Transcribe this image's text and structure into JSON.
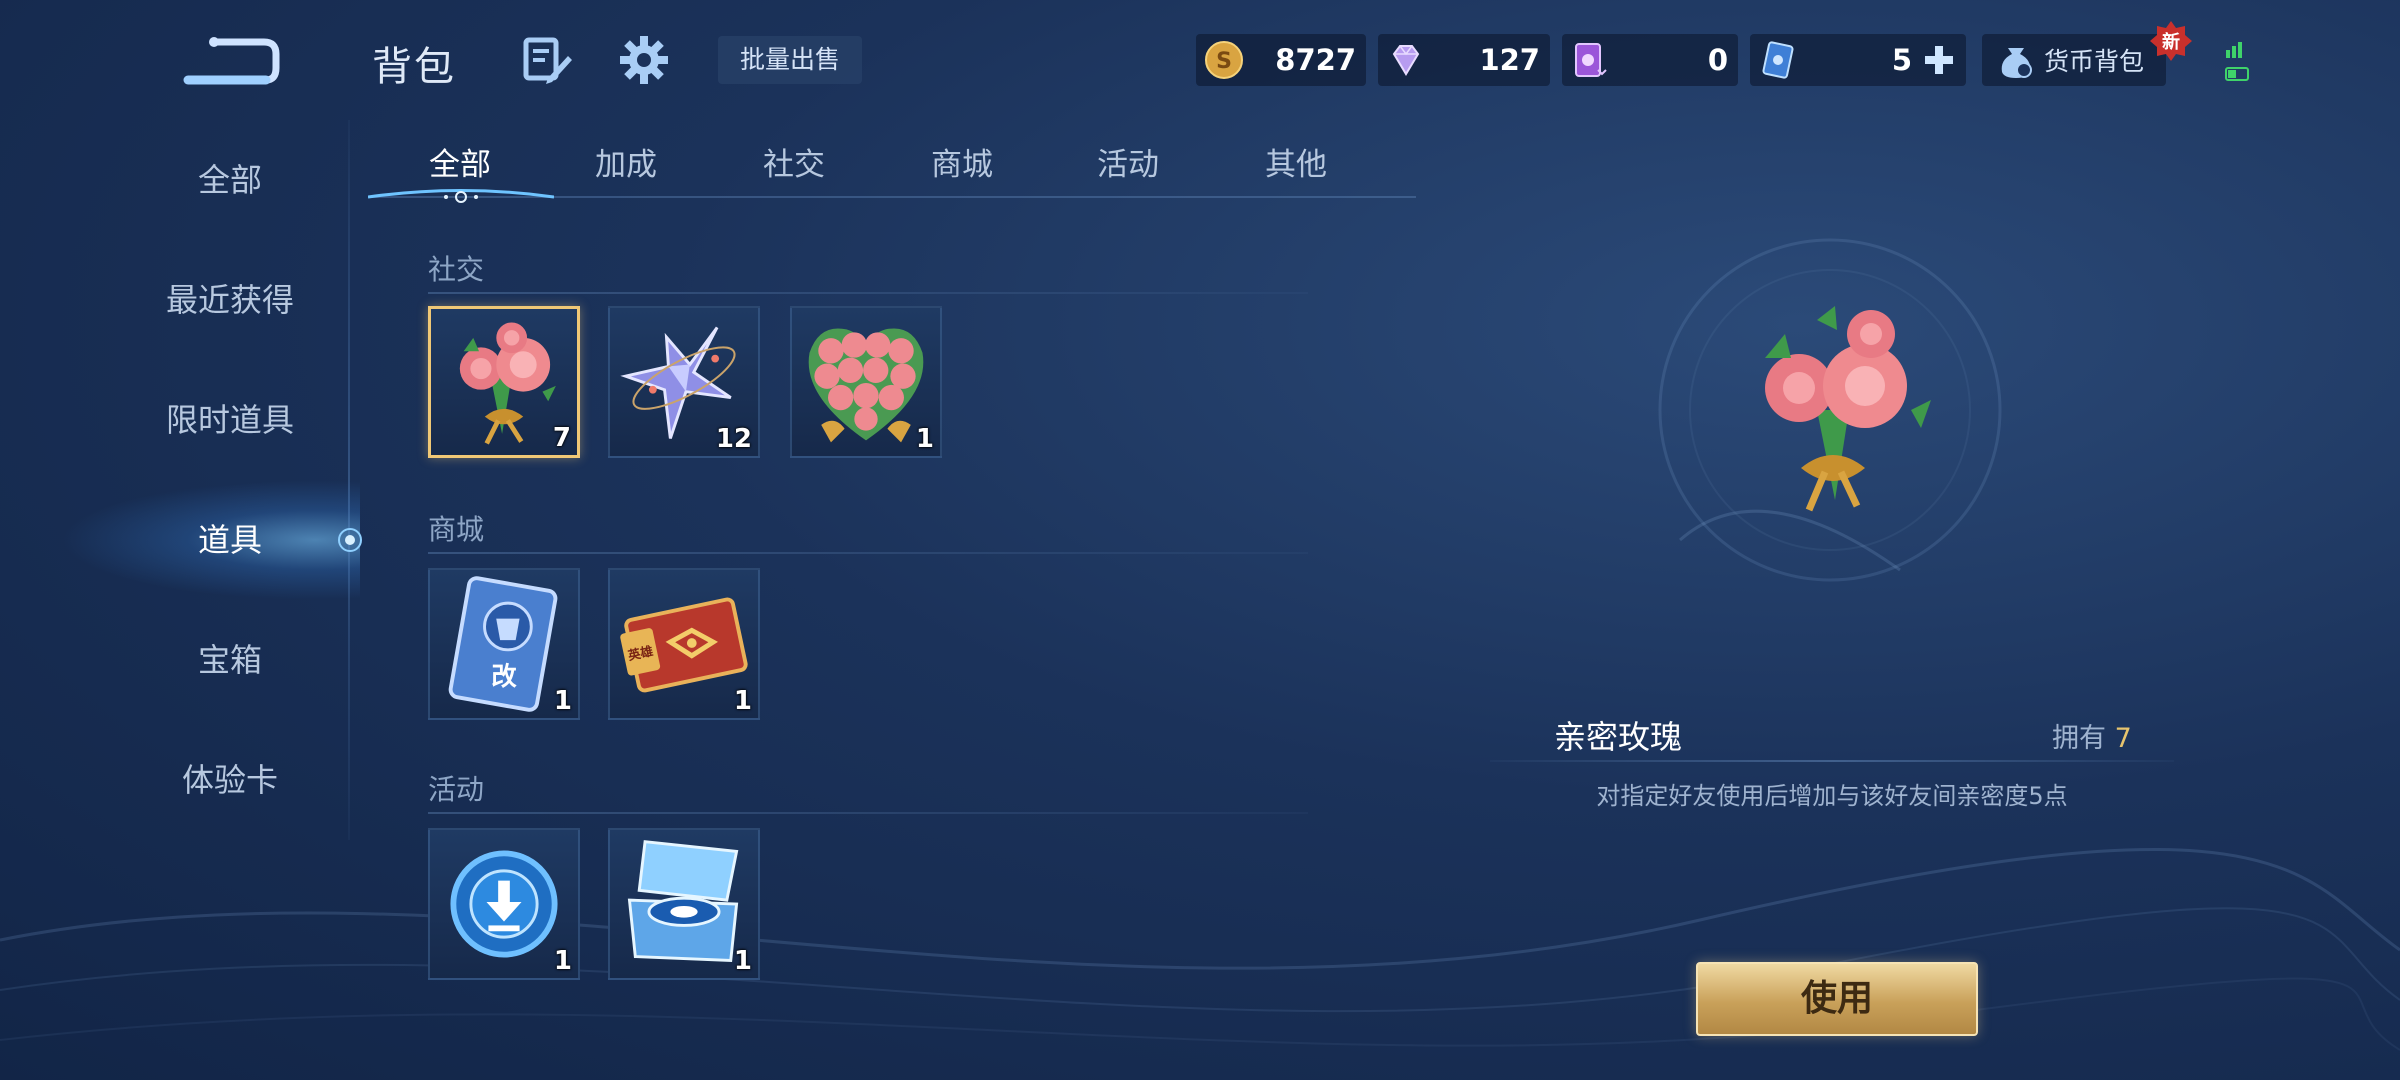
{
  "header": {
    "title": "背包",
    "bulk_sell_label": "批量出售",
    "wallet_label": "货币背包",
    "new_badge": "新"
  },
  "currencies": {
    "gold": "8727",
    "diamond": "127",
    "card": "0",
    "ticket": "5"
  },
  "sidebar": {
    "items": [
      {
        "label": "全部"
      },
      {
        "label": "最近获得"
      },
      {
        "label": "限时道具"
      },
      {
        "label": "道具"
      },
      {
        "label": "宝箱"
      },
      {
        "label": "体验卡"
      }
    ],
    "active": "道具"
  },
  "tabs": {
    "items": [
      {
        "label": "全部"
      },
      {
        "label": "加成"
      },
      {
        "label": "社交"
      },
      {
        "label": "商城"
      },
      {
        "label": "活动"
      },
      {
        "label": "其他"
      }
    ],
    "active": "全部"
  },
  "sections": [
    {
      "title": "社交",
      "items": [
        {
          "icon": "rose-bouquet-icon",
          "qty": "7"
        },
        {
          "icon": "star-gift-icon",
          "qty": "12"
        },
        {
          "icon": "heart-rose-bouquet-icon",
          "qty": "1"
        }
      ]
    },
    {
      "title": "商城",
      "items": [
        {
          "icon": "rename-card-icon",
          "qty": "1"
        },
        {
          "icon": "hero-ticket-icon",
          "qty": "1"
        }
      ]
    },
    {
      "title": "活动",
      "items": [
        {
          "icon": "download-badge-icon",
          "qty": "1"
        },
        {
          "icon": "crystal-chest-icon",
          "qty": "1"
        }
      ]
    }
  ],
  "rename_card_glyph": "改",
  "hero_ticket_glyph": "英雄",
  "detail": {
    "name": "亲密玫瑰",
    "owned_label": "拥有",
    "owned_count": "7",
    "description": "对指定好友使用后增加与该好友间亲密度5点",
    "use_label": "使用"
  },
  "colors": {
    "accent_gold": "#e6c46e",
    "selected_border": "#f0c876",
    "background": "#1b325a"
  }
}
